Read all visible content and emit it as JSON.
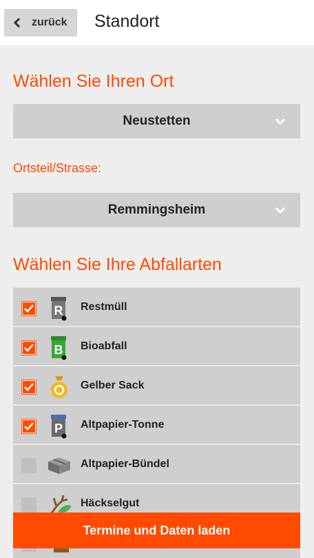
{
  "header": {
    "back_label": "zurück",
    "title": "Standort"
  },
  "location": {
    "heading": "Wählen Sie Ihren Ort",
    "selected_place": "Neustetten",
    "district_label": "Ortsteil/Strasse:",
    "selected_district": "Remmingsheim"
  },
  "waste": {
    "heading": "Wählen Sie Ihre Abfallarten",
    "items": [
      {
        "label": "Restmüll",
        "checked": true,
        "icon": "restmuell-bin-icon"
      },
      {
        "label": "Bioabfall",
        "checked": true,
        "icon": "bio-bin-icon"
      },
      {
        "label": "Gelber Sack",
        "checked": true,
        "icon": "yellow-sack-icon"
      },
      {
        "label": "Altpapier-Tonne",
        "checked": true,
        "icon": "paper-bin-icon"
      },
      {
        "label": "Altpapier-Bündel",
        "checked": false,
        "icon": "paper-bundle-icon"
      },
      {
        "label": "Häckselgut",
        "checked": false,
        "icon": "branch-icon"
      }
    ]
  },
  "cta": {
    "label": "Termine und Daten laden"
  },
  "colors": {
    "accent": "#ff4a00",
    "row_bg": "#cfcfcf",
    "page_bg": "#eeeeee"
  }
}
